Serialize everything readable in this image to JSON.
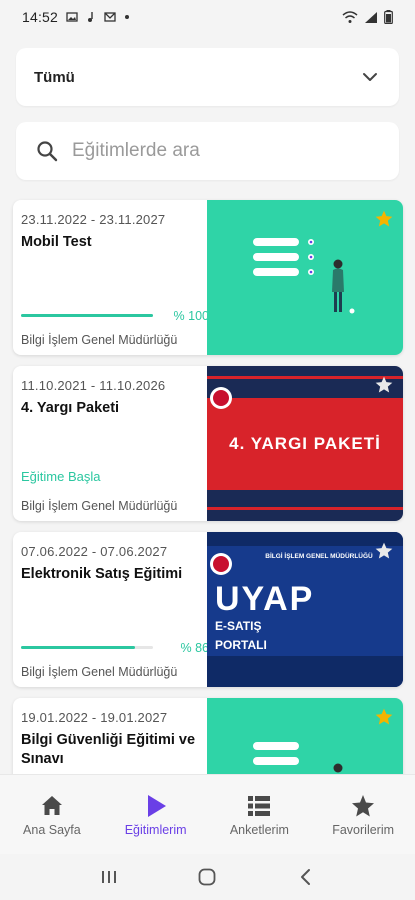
{
  "status_bar": {
    "time": "14:52"
  },
  "filter": {
    "selected": "Tümü"
  },
  "search": {
    "placeholder": "Eğitimlerde ara"
  },
  "courses": [
    {
      "dates": "23.11.2022 - 23.11.2027",
      "title": "Mobil Test",
      "progress_percent": 100,
      "progress_label": "% 100",
      "org": "Bilgi İşlem Genel Müdürlüğü",
      "favorite": true
    },
    {
      "dates": "11.10.2021 - 11.10.2026",
      "title": "4. Yargı Paketi",
      "action_label": "Eğitime Başla",
      "org": "Bilgi İşlem Genel Müdürlüğü",
      "favorite": false,
      "thumb_text": "4. YARGI PAKETİ"
    },
    {
      "dates": "07.06.2022 - 07.06.2027",
      "title": "Elektronik Satış Eğitimi",
      "progress_percent": 86,
      "progress_label": "% 86",
      "org": "Bilgi İşlem Genel Müdürlüğü",
      "favorite": false,
      "thumb_header": "BİLGİ İŞLEM GENEL MÜDÜRLÜĞÜ",
      "thumb_title": "UYAP",
      "thumb_sub1": "E-SATIŞ",
      "thumb_sub2": "PORTALI"
    },
    {
      "dates": "19.01.2022 - 19.01.2027",
      "title": "Bilgi Güvenliği Eğitimi ve Sınavı",
      "favorite": true
    }
  ],
  "bottom_nav": [
    {
      "label": "Ana Sayfa",
      "icon": "home-icon"
    },
    {
      "label": "Eğitimlerim",
      "icon": "play-icon",
      "active": true
    },
    {
      "label": "Anketlerim",
      "icon": "list-icon"
    },
    {
      "label": "Favorilerim",
      "icon": "star-icon"
    }
  ],
  "colors": {
    "accent": "#2bc7a0",
    "active_nav": "#6a3fe6",
    "favorite_star": "#f4b400",
    "thumb_teal": "#2fd4a7",
    "thumb_red": "#d8232a",
    "thumb_blue": "#163a8c"
  }
}
